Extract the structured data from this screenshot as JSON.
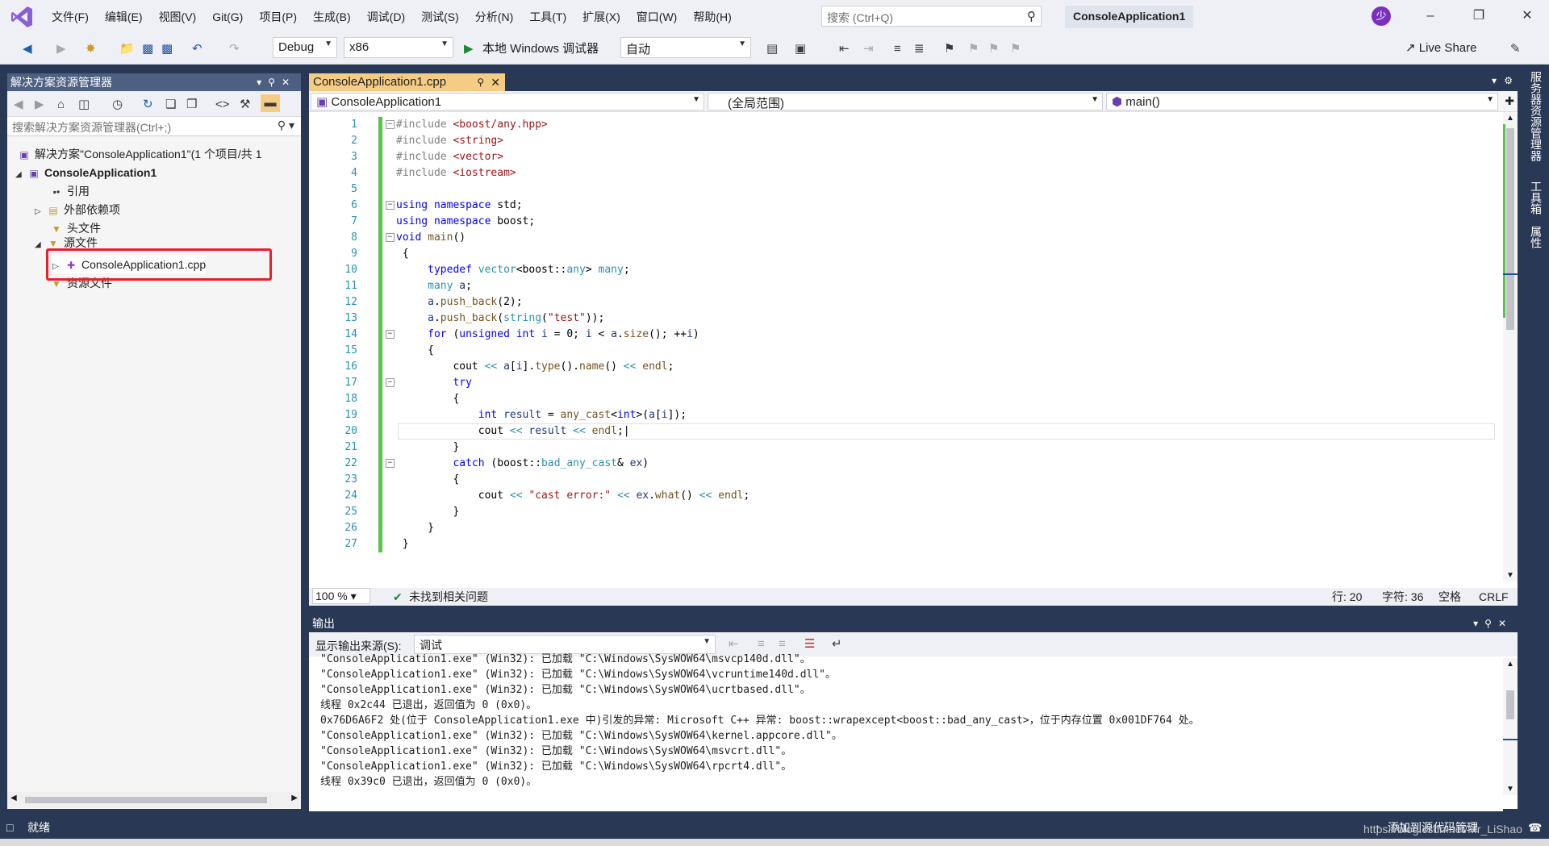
{
  "menubar": {
    "items": [
      "文件(F)",
      "编辑(E)",
      "视图(V)",
      "Git(G)",
      "项目(P)",
      "生成(B)",
      "调试(D)",
      "测试(S)",
      "分析(N)",
      "工具(T)",
      "扩展(X)",
      "窗口(W)",
      "帮助(H)"
    ],
    "search_placeholder": "搜索 (Ctrl+Q)",
    "title": "ConsoleApplication1",
    "avatar": "少"
  },
  "toolbar": {
    "config": "Debug",
    "platform": "x86",
    "run_label": "本地 Windows 调试器",
    "auto": "自动",
    "live_share": "Live Share"
  },
  "solution_explorer": {
    "title": "解决方案资源管理器",
    "search_placeholder": "搜索解决方案资源管理器(Ctrl+;)",
    "items": [
      "解决方案\"ConsoleApplication1\"(1 个项目/共 1",
      "ConsoleApplication1",
      "引用",
      "外部依赖项",
      "头文件",
      "源文件",
      "ConsoleApplication1.cpp",
      "资源文件"
    ]
  },
  "editor": {
    "tab": "ConsoleApplication1.cpp",
    "nav_project": "ConsoleApplication1",
    "nav_scope": "(全局范围)",
    "nav_member": "main()",
    "line_numbers": [
      "1",
      "2",
      "3",
      "4",
      "5",
      "6",
      "7",
      "8",
      "9",
      "10",
      "11",
      "12",
      "13",
      "14",
      "15",
      "16",
      "17",
      "18",
      "19",
      "20",
      "21",
      "22",
      "23",
      "24",
      "25",
      "26",
      "27"
    ],
    "zoom": "100 %",
    "issues": "未找到相关问题",
    "row": "行: 20",
    "col": "字符: 36",
    "spaces": "空格",
    "eol": "CRLF"
  },
  "output": {
    "title": "输出",
    "source_label": "显示输出来源(S):",
    "source_value": "调试",
    "lines": [
      "\"ConsoleApplication1.exe\" (Win32): 已加载 \"C:\\Windows\\SysWOW64\\msvcp140d.dll\"。",
      "\"ConsoleApplication1.exe\" (Win32): 已加载 \"C:\\Windows\\SysWOW64\\vcruntime140d.dll\"。",
      "\"ConsoleApplication1.exe\" (Win32): 已加载 \"C:\\Windows\\SysWOW64\\ucrtbased.dll\"。",
      "线程 0x2c44 已退出，返回值为 0 (0x0)。",
      "0x76D6A6F2 处(位于 ConsoleApplication1.exe 中)引发的异常: Microsoft C++ 异常: boost::wrapexcept<boost::bad_any_cast>，位于内存位置 0x001DF764 处。",
      "\"ConsoleApplication1.exe\" (Win32): 已加载 \"C:\\Windows\\SysWOW64\\kernel.appcore.dll\"。",
      "\"ConsoleApplication1.exe\" (Win32): 已加载 \"C:\\Windows\\SysWOW64\\msvcrt.dll\"。",
      "\"ConsoleApplication1.exe\" (Win32): 已加载 \"C:\\Windows\\SysWOW64\\rpcrt4.dll\"。",
      "线程 0x39c0 已退出，返回值为 0 (0x0)。"
    ]
  },
  "right_strip": [
    "服务器资源管理器",
    "工具箱",
    "属性"
  ],
  "statusbar": {
    "ready": "就绪",
    "source_control": "添加到源代码管理",
    "watermark": "https://blog.csdn.net/Mr_LiShao"
  },
  "colors": {
    "accent": "#293955",
    "tab_active": "#f5cc84",
    "highlight_box": "#e8202a"
  }
}
